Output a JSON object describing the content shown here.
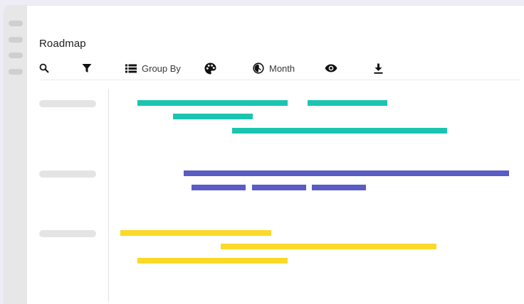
{
  "title": "Roadmap",
  "toolbar": {
    "group_by_label": "Group By",
    "period_label": "Month",
    "icons": [
      "search-icon",
      "filter-icon",
      "list-icon",
      "palette-icon",
      "half-circle-icon",
      "eye-icon",
      "download-icon"
    ]
  },
  "colors": {
    "teal": "#1bc4b0",
    "indigo": "#5b5bc4",
    "yellow": "#fbd92a",
    "background": "#eeedf5",
    "rail": "#e7e7e7"
  },
  "groups": [
    {
      "color": "teal",
      "bars": 4
    },
    {
      "color": "indigo",
      "bars": 4
    },
    {
      "color": "yellow",
      "bars": 3
    }
  ]
}
